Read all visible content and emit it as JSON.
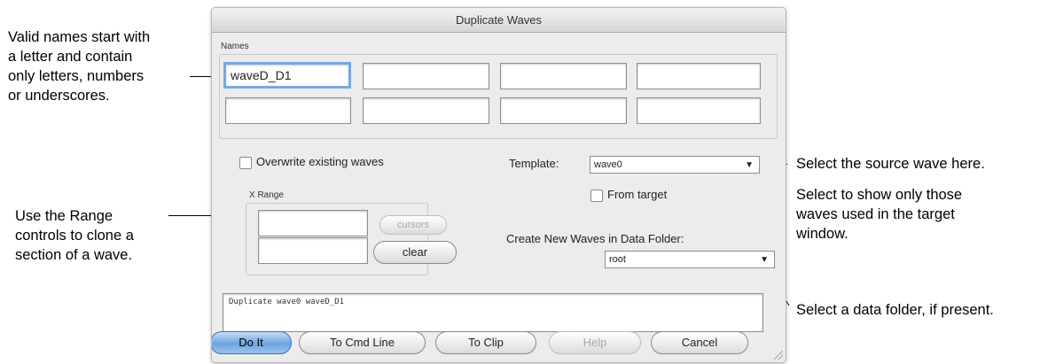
{
  "annotations": {
    "names": [
      "Valid names start with",
      "a letter and contain",
      "only letters, numbers",
      "or underscores."
    ],
    "range": [
      "Use the Range",
      "controls to clone a",
      "section of a wave."
    ],
    "template": [
      "Select the source wave here."
    ],
    "from_target": [
      "Select to show only those",
      "waves used in the target",
      "window."
    ],
    "data_folder": [
      "Select a data folder, if present."
    ]
  },
  "dialog": {
    "title": "Duplicate Waves",
    "names_label": "Names",
    "name_fields": [
      "waveD_D1",
      "",
      "",
      "",
      "",
      "",
      "",
      ""
    ],
    "overwrite_label": "Overwrite existing waves",
    "overwrite_checked": false,
    "xrange_label": "X Range",
    "xrange_fields": [
      "",
      ""
    ],
    "cursors_label": "cursors",
    "clear_label": "clear",
    "template_label": "Template:",
    "template_value": "wave0",
    "from_target_label": "From target",
    "from_target_checked": false,
    "data_folder_label": "Create New Waves in Data Folder:",
    "data_folder_value": "root",
    "command_text": "Duplicate wave0 waveD_D1",
    "buttons": {
      "do_it": "Do It",
      "to_cmd_line": "To Cmd Line",
      "to_clip": "To Clip",
      "help": "Help",
      "cancel": "Cancel"
    }
  }
}
